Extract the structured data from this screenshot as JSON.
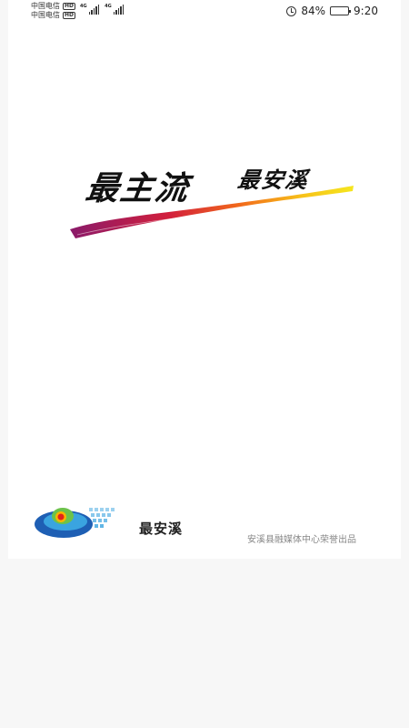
{
  "status_bar": {
    "carrier_1": "中国电信",
    "carrier_2": "中国电信",
    "network_1": "4G",
    "network_2": "4G",
    "battery": "84%",
    "battery_level": 0.84,
    "time": "9:20",
    "icons": [
      "hd-icon",
      "signal-icon",
      "alarm-icon",
      "battery-icon"
    ]
  },
  "splash": {
    "slogan_main": "最主流",
    "slogan_sub": "最安溪",
    "stroke_colors": [
      "#8a1a6a",
      "#d21f3c",
      "#f26a1b",
      "#f7c21a",
      "#f5e61e"
    ]
  },
  "footer": {
    "brand_name": "最安溪",
    "credit": "安溪县融媒体中心荣誉出品",
    "logo_icon": "anxi-media-logo-icon",
    "logo_colors": [
      "#1e5fb4",
      "#3aa4e0",
      "#6cc24a",
      "#f7b500",
      "#e2231a"
    ]
  }
}
